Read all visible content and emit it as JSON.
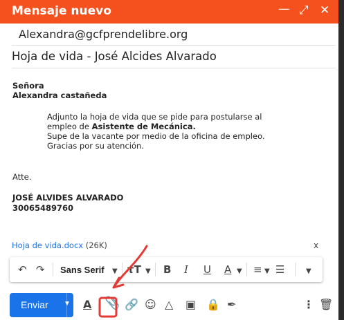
{
  "window": {
    "title": "Mensaje nuevo"
  },
  "titlebar_icons": [
    "minimize-icon",
    "expand-icon",
    "close-icon"
  ],
  "to": {
    "value": "Alexandra@gcfprendelibre.org"
  },
  "subject": {
    "value": "Hoja de vida - José Alcides Alvarado"
  },
  "body": {
    "salutation1": "Señora",
    "salutation2": "Alexandra castañeda",
    "para_line1": "Adjunto la hoja de vida que se pide para postularse al",
    "para_line2_prefix": "empleo de ",
    "para_line2_bold": "Asistente de Mecánica.",
    "para_line3": "Supe de la vacante por medio de la oficina de empleo.",
    "para_line4": "Gracias por su atención.",
    "closing": "Atte.",
    "sig_name": "JOSÉ ALVIDES ALVARADO",
    "sig_phone": "30065489760"
  },
  "attachment": {
    "name": "Hoja de vida.docx",
    "size": "(26K)",
    "remove": "x"
  },
  "format_toolbar": {
    "font": "Sans Serif"
  },
  "bottom_toolbar": {
    "send_label": "Enviar"
  },
  "colors": {
    "accent": "#f4511e",
    "send": "#1a73e8",
    "annotation": "#e53935"
  }
}
